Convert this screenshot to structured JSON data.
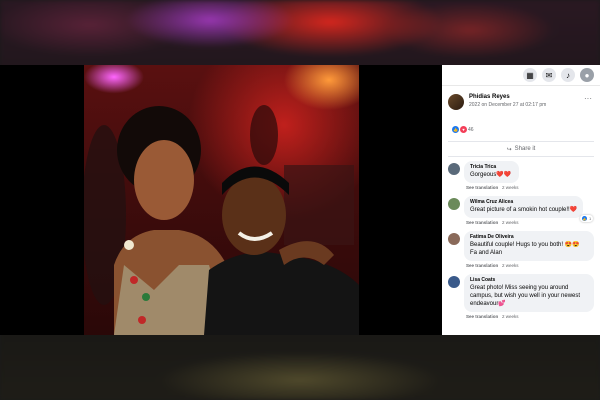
{
  "post": {
    "author": "Phidias Reyes",
    "date": "2022 on December 27 at 02:17 pm",
    "reaction_count": "46",
    "share_label": "Share it"
  },
  "comments": [
    {
      "name": "Tricia Trica",
      "text": "Gorgeous❤️❤️",
      "translation": "See translation",
      "time": "2 weeks",
      "avatar_color": "#5a6a7a"
    },
    {
      "name": "Wilma Cruz Alicea",
      "text": "Great picture of a smokin hot couple!!❤️",
      "translation": "See translation",
      "time": "2 weeks",
      "avatar_color": "#6b8a5a",
      "reaction": "1"
    },
    {
      "name": "Fatima De Oliveira",
      "text": "Beautiful couple! Hugs to you both! 😍😍 Fa and Alan",
      "translation": "See translation",
      "time": "2 weeks",
      "avatar_color": "#8a6a5a"
    },
    {
      "name": "Lisa Coats",
      "text": "Great photo! Miss seeing you around campus, but wish you well in your newest endeavour💕",
      "translation": "See translation",
      "time": "2 weeks",
      "avatar_color": "#3a5a8a"
    }
  ],
  "icons": [
    "grid-icon",
    "messenger-icon",
    "bell-icon",
    "profile-icon"
  ]
}
